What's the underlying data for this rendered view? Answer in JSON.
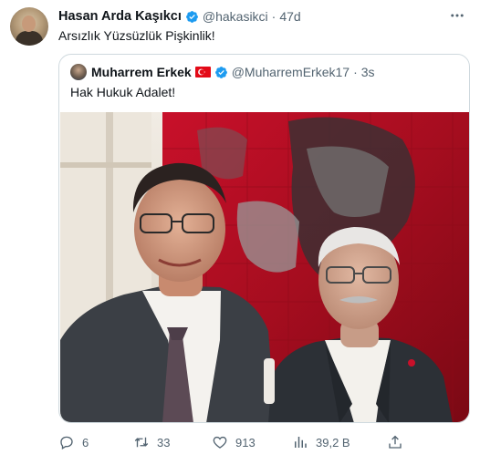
{
  "author": {
    "name": "Hasan Arda Kaşıkcı",
    "handle": "@hakasikci",
    "separator": "·",
    "time": "47d",
    "text": "Arsızlık Yüzsüzlük Pişkinlik!"
  },
  "quoted": {
    "name": "Muharrem Erkek",
    "handle": "@MuharremErkek17",
    "separator": "·",
    "time": "3s",
    "text": "Hak Hukuk Adalet!",
    "flag_icon": "turkish-flag-icon"
  },
  "actions": {
    "replies": "6",
    "reposts": "33",
    "likes": "913",
    "views": "39,2 B"
  },
  "colors": {
    "verified": "#1d9bf0",
    "muted": "#536471",
    "border": "#cfd9de",
    "text": "#0f1419"
  }
}
